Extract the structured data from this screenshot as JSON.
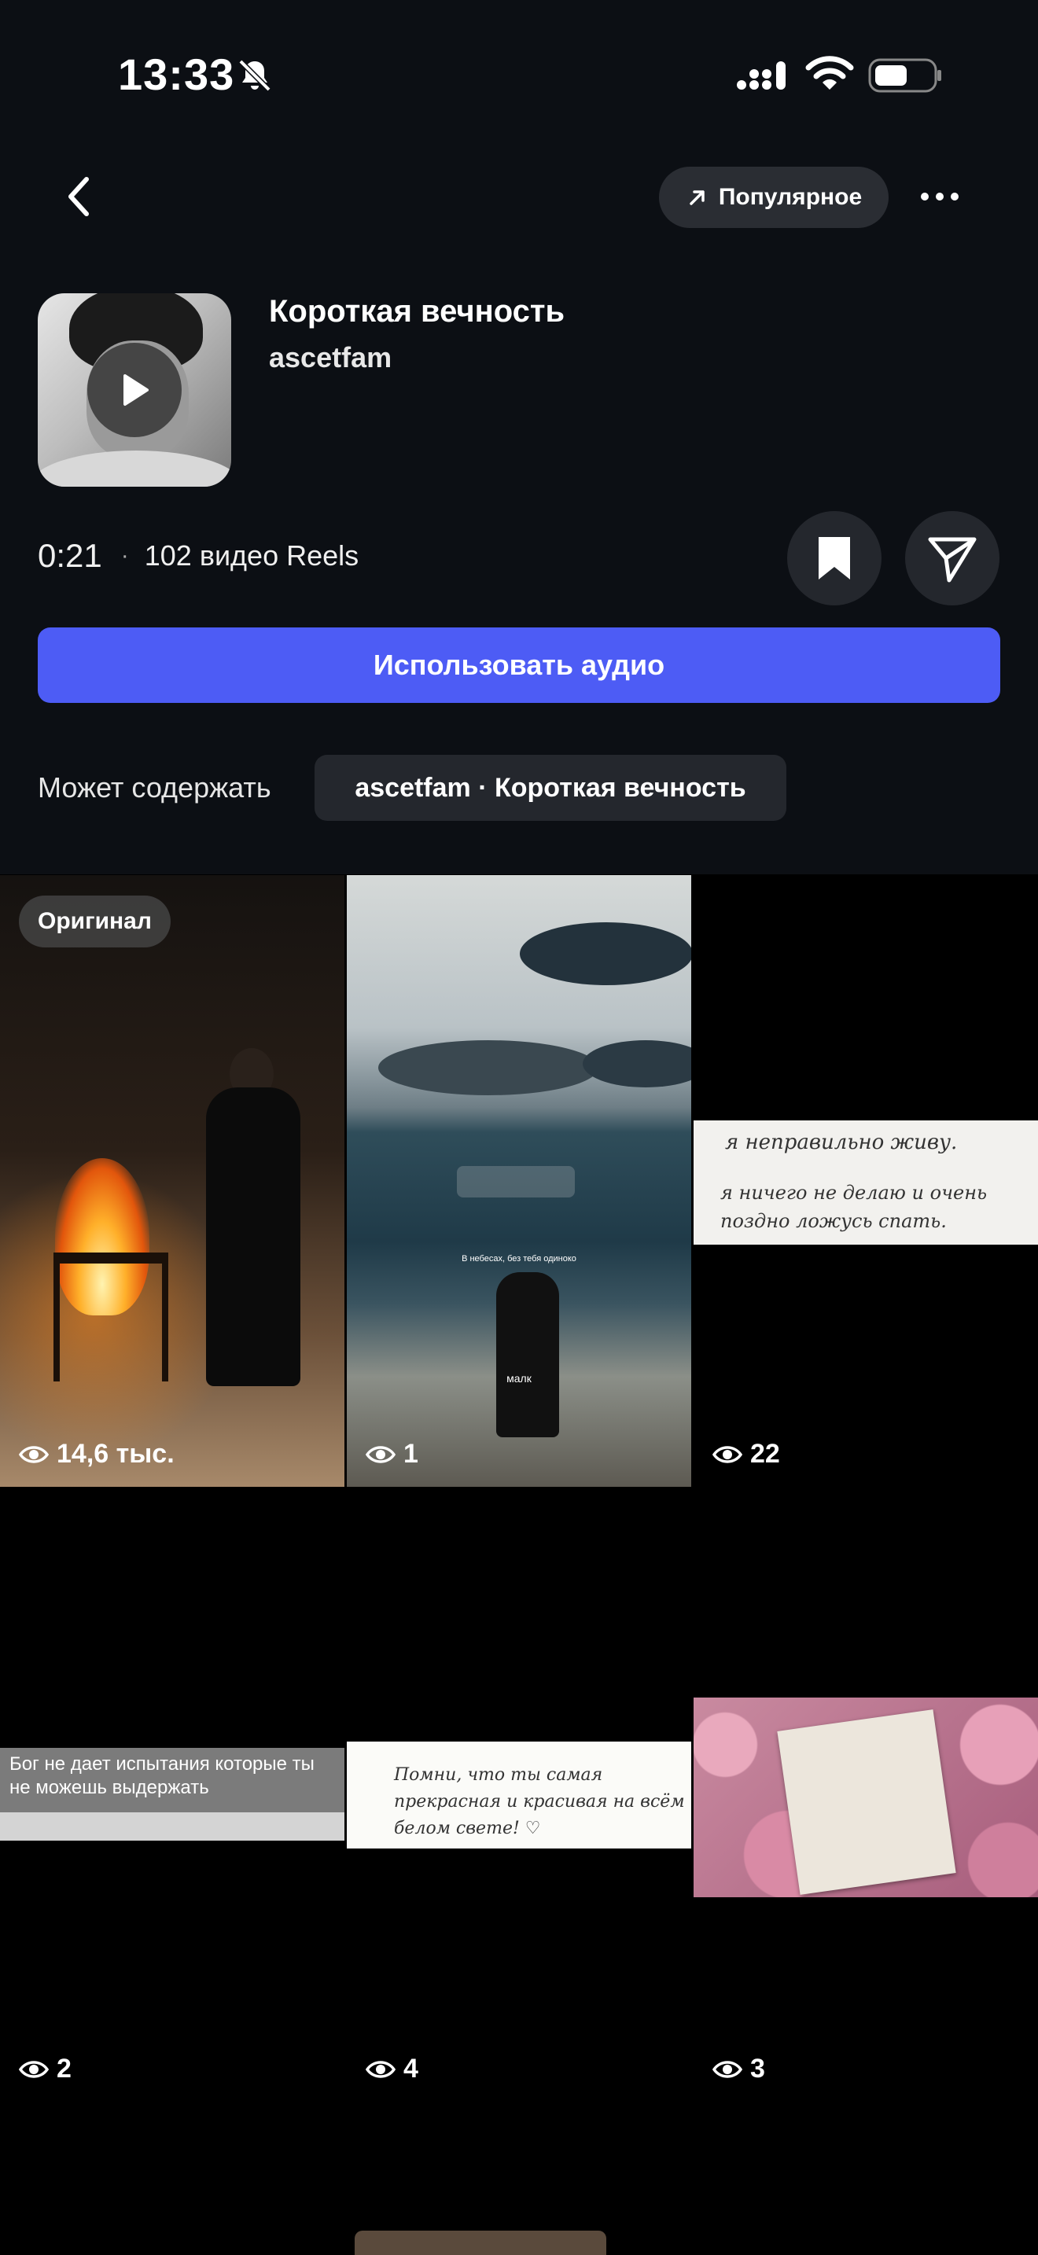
{
  "status_bar": {
    "time": "13:33"
  },
  "nav": {
    "popular_label": "Популярное"
  },
  "audio": {
    "title": "Короткая вечность",
    "artist": "ascetfam",
    "duration": "0:21",
    "dot": "·",
    "reels_count": "102 видео Reels"
  },
  "actions": {
    "use_audio_label": "Использовать аудио"
  },
  "contains": {
    "label": "Может содержать",
    "chip": "ascetfam · Короткая вечность"
  },
  "grid": {
    "original_badge": "Оригинал",
    "tiles": [
      {
        "views": "14,6 тыс."
      },
      {
        "views": "1",
        "caption_top": "В небесах, без тебя одиноко",
        "caption_bottom": "малк"
      },
      {
        "views": "22",
        "note_line1": "я неправильно живу.",
        "note_line2": "я ничего не делаю и очень поздно ложусь спать."
      },
      {
        "views": "2",
        "strip_text": "Бог не дает испытания которые ты не можешь выдержать"
      },
      {
        "views": "4",
        "note_text": "Помни, что ты самая прекрасная и красивая на всём белом свете! ♡"
      },
      {
        "views": "3"
      }
    ]
  },
  "colors": {
    "header_bg": "#0c0f14",
    "accent": "#4d5cf5",
    "chip_bg": "#24272d"
  },
  "icons": [
    "bell-off-icon",
    "signal-icon",
    "wifi-icon",
    "battery-icon",
    "back-arrow-icon",
    "trend-arrow-icon",
    "more-dots-icon",
    "play-icon",
    "bookmark-icon",
    "send-icon",
    "eye-icon"
  ]
}
